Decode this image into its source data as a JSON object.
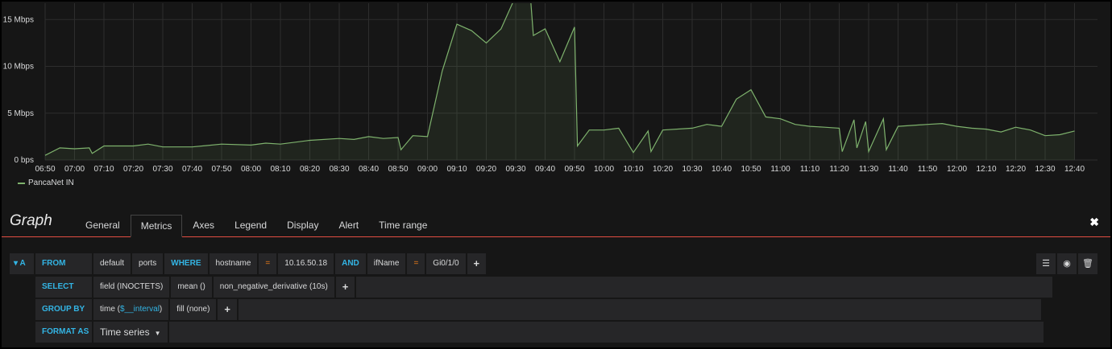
{
  "chart_data": {
    "type": "area",
    "y_ticks": [
      "0 bps",
      "5 Mbps",
      "10 Mbps",
      "15 Mbps"
    ],
    "x_ticks": [
      "06:50",
      "07:00",
      "07:10",
      "07:20",
      "07:30",
      "07:40",
      "07:50",
      "08:00",
      "08:10",
      "08:20",
      "08:30",
      "08:40",
      "08:50",
      "09:00",
      "09:10",
      "09:20",
      "09:30",
      "09:40",
      "09:50",
      "10:00",
      "10:10",
      "10:20",
      "10:30",
      "10:40",
      "10:50",
      "11:00",
      "11:10",
      "11:20",
      "11:30",
      "11:40",
      "11:50",
      "12:00",
      "12:10",
      "12:20",
      "12:30",
      "12:40"
    ],
    "ylim": [
      0,
      20
    ],
    "grid": true,
    "legend_position": "bottom-left",
    "series": [
      {
        "name": "PancaNet IN",
        "color": "#7eb26d",
        "points": [
          [
            "06:50",
            0.5
          ],
          [
            "06:55",
            1.3
          ],
          [
            "07:00",
            1.2
          ],
          [
            "07:05",
            1.3
          ],
          [
            "07:06",
            0.7
          ],
          [
            "07:10",
            1.5
          ],
          [
            "07:20",
            1.5
          ],
          [
            "07:25",
            1.7
          ],
          [
            "07:30",
            1.4
          ],
          [
            "07:40",
            1.4
          ],
          [
            "07:50",
            1.7
          ],
          [
            "08:00",
            1.6
          ],
          [
            "08:05",
            1.8
          ],
          [
            "08:10",
            1.7
          ],
          [
            "08:20",
            2.1
          ],
          [
            "08:30",
            2.3
          ],
          [
            "08:35",
            2.2
          ],
          [
            "08:40",
            2.5
          ],
          [
            "08:45",
            2.3
          ],
          [
            "08:50",
            2.4
          ],
          [
            "08:51",
            1.1
          ],
          [
            "08:55",
            2.6
          ],
          [
            "09:00",
            2.5
          ],
          [
            "09:05",
            9.5
          ],
          [
            "09:10",
            14.5
          ],
          [
            "09:15",
            13.8
          ],
          [
            "09:20",
            12.5
          ],
          [
            "09:25",
            14.0
          ],
          [
            "09:30",
            17.5
          ],
          [
            "09:35",
            17.4
          ],
          [
            "09:36",
            13.3
          ],
          [
            "09:40",
            14.0
          ],
          [
            "09:45",
            10.5
          ],
          [
            "09:50",
            14.2
          ],
          [
            "09:51",
            1.5
          ],
          [
            "09:55",
            3.2
          ],
          [
            "10:00",
            3.2
          ],
          [
            "10:05",
            3.4
          ],
          [
            "10:10",
            0.8
          ],
          [
            "10:15",
            3.1
          ],
          [
            "10:16",
            0.9
          ],
          [
            "10:20",
            3.2
          ],
          [
            "10:30",
            3.4
          ],
          [
            "10:35",
            3.8
          ],
          [
            "10:40",
            3.6
          ],
          [
            "10:45",
            6.5
          ],
          [
            "10:50",
            7.5
          ],
          [
            "10:55",
            4.6
          ],
          [
            "11:00",
            4.4
          ],
          [
            "11:05",
            3.8
          ],
          [
            "11:10",
            3.6
          ],
          [
            "11:15",
            3.5
          ],
          [
            "11:20",
            3.4
          ],
          [
            "11:21",
            0.9
          ],
          [
            "11:25",
            4.3
          ],
          [
            "11:26",
            1.3
          ],
          [
            "11:29",
            4.1
          ],
          [
            "11:30",
            0.9
          ],
          [
            "11:35",
            4.4
          ],
          [
            "11:36",
            1.1
          ],
          [
            "11:40",
            3.6
          ],
          [
            "11:50",
            3.8
          ],
          [
            "11:55",
            3.9
          ],
          [
            "12:00",
            3.6
          ],
          [
            "12:05",
            3.4
          ],
          [
            "12:10",
            3.3
          ],
          [
            "12:15",
            3.0
          ],
          [
            "12:20",
            3.5
          ],
          [
            "12:25",
            3.2
          ],
          [
            "12:30",
            2.6
          ],
          [
            "12:35",
            2.7
          ],
          [
            "12:40",
            3.1
          ]
        ]
      }
    ]
  },
  "editor": {
    "title": "Graph",
    "tabs": [
      "General",
      "Metrics",
      "Axes",
      "Legend",
      "Display",
      "Alert",
      "Time range"
    ],
    "active_tab": "Metrics",
    "close_icon": "close-icon"
  },
  "query": {
    "ref_id": "A",
    "from_label": "FROM",
    "policy": "default",
    "measurement": "ports",
    "where_label": "WHERE",
    "where_key1": "hostname",
    "where_op1": "=",
    "where_val1": "10.16.50.18",
    "and_label": "AND",
    "where_key2": "ifName",
    "where_op2": "=",
    "where_val2": "Gi0/1/0",
    "add": "+",
    "select_label": "SELECT",
    "field": "field (INOCTETS)",
    "agg": "mean ()",
    "transform": "non_negative_derivative (10s)",
    "group_label": "GROUP BY",
    "group_time_prefix": "time (",
    "group_time_var": "$__interval",
    "group_time_suffix": ")",
    "group_fill": "fill (none)",
    "format_label": "FORMAT AS",
    "format_value": "Time series"
  }
}
